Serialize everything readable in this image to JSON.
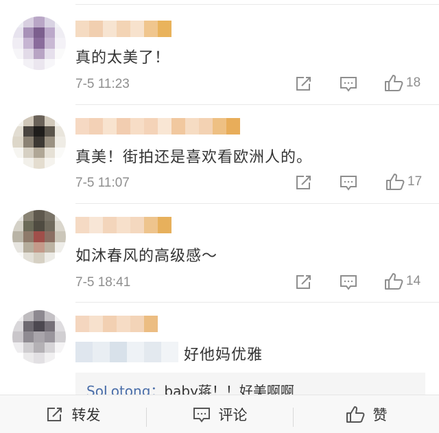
{
  "comments": [
    {
      "name": "",
      "text": "真的太美了！",
      "time": "7-5 11:23",
      "likes": "18",
      "avatar_colors": [
        "#ececf2",
        "#d8cfe0",
        "#b9a6c6",
        "#d9d3e3",
        "#f2f2f6",
        "#e7e3ee",
        "#a892b8",
        "#7c5f8e",
        "#bca9ca",
        "#efedf3",
        "#f0edf4",
        "#c6b5d2",
        "#8a6c9c",
        "#c9b9d4",
        "#f4f2f7",
        "#f6f5f8",
        "#e2dbe8",
        "#b8a4c4",
        "#e6e0ec",
        "#fafafa",
        "#ffffff",
        "#f3f1f6",
        "#ebe6ef",
        "#f7f6f9",
        "#ffffff"
      ],
      "name_colors": [
        "#f5dbc2",
        "#f1cfb0",
        "#f7e4d1",
        "#f3d4b5",
        "#f7e2cd",
        "#f0c68e",
        "#e9b35c"
      ]
    },
    {
      "name": "",
      "text": "真美！街拍还是喜欢看欧洲人的。",
      "time": "7-5 11:07",
      "likes": "17",
      "avatar_colors": [
        "#f3f1ec",
        "#cfc6b8",
        "#6a6259",
        "#d1c9bb",
        "#f4f3ef",
        "#e2ddd2",
        "#4a4540",
        "#1f1d1b",
        "#5b554c",
        "#e9e5dc",
        "#ddd7c9",
        "#8b8274",
        "#3c3833",
        "#9a9182",
        "#efece5",
        "#f6f5f1",
        "#d6d0c3",
        "#b0a796",
        "#e6e1d6",
        "#fafaf8",
        "#ffffff",
        "#f2f0ea",
        "#e4ddcf",
        "#f5f3ee",
        "#ffffff"
      ],
      "name_colors": [
        "#f6d9c3",
        "#f3d1b6",
        "#f8e3cf",
        "#f2cdb0",
        "#f7ddc6",
        "#f4d3b8",
        "#f9e6d4",
        "#f1c89f",
        "#f6dcc3",
        "#f3d2b3",
        "#eec083",
        "#e8ad5a"
      ]
    },
    {
      "name": "",
      "text": "如沐春风的高级感～",
      "time": "7-5 18:41",
      "likes": "14",
      "avatar_colors": [
        "#e9e8e4",
        "#8a8475",
        "#5e584d",
        "#7a7468",
        "#e6e4de",
        "#d4d1c7",
        "#6b6a58",
        "#4f4b41",
        "#706a5d",
        "#dad6cc",
        "#b9b4a6",
        "#8e7a6a",
        "#a04f4a",
        "#8b6f63",
        "#cbc6b9",
        "#e7e5e0",
        "#b5ad9c",
        "#c49a8a",
        "#bcb3a3",
        "#efeeea",
        "#fafaf9",
        "#e3e0d8",
        "#d6d0c3",
        "#ecebe6",
        "#ffffff"
      ],
      "name_colors": [
        "#f5dac4",
        "#f8e6d6",
        "#f3d5bb",
        "#f7e0cb",
        "#f4d8bf",
        "#eec48d",
        "#e7b05c"
      ]
    },
    {
      "name": "",
      "text": "好他妈优雅",
      "time": "",
      "likes": "",
      "avatar_colors": [
        "#f1f0f1",
        "#bfbcbf",
        "#8d8990",
        "#c4c1c5",
        "#f2f1f2",
        "#d9d7da",
        "#6d6970",
        "#4c4850",
        "#757078",
        "#dedcdf",
        "#c9c6ca",
        "#8f8b92",
        "#a9a5ab",
        "#9a969d",
        "#d1cfd2",
        "#eeedef",
        "#cfcdd0",
        "#b4b1b5",
        "#d6d4d7",
        "#f5f4f5",
        "#ffffff",
        "#ebeaeb",
        "#e2e0e3",
        "#f1f0f1",
        "#ffffff"
      ],
      "name_colors": [
        "#f4d6bf",
        "#f7e1cd",
        "#f2d0b2",
        "#f6dcc5",
        "#f3d4b8",
        "#ecbd82"
      ],
      "quote_colors": [
        "#dfe6ee",
        "#e9eef3",
        "#d8e1ea",
        "#eef2f6",
        "#e3e9ef",
        "#f1f4f7"
      ]
    }
  ],
  "reply": {
    "user": "SoLotong",
    "separator": "：",
    "text": "baby蒋！！好美啊啊"
  },
  "bottom_bar": {
    "repost_label": "转发",
    "comment_label": "评论",
    "like_label": "赞"
  },
  "icons": {
    "repost": "repost-icon",
    "comment": "comment-icon",
    "like": "thumbs-up-icon"
  }
}
